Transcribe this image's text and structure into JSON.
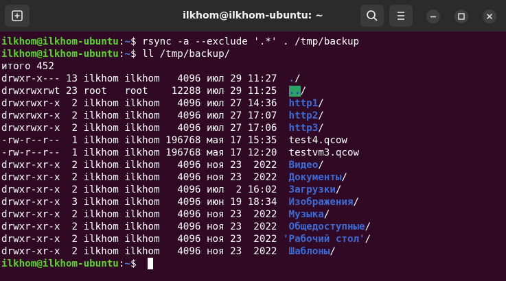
{
  "window": {
    "title": "ilkhom@ilkhom-ubuntu: ~"
  },
  "icons": {
    "new_tab": "new-tab-icon",
    "search": "search-icon",
    "menu": "hamburger-menu-icon",
    "minimize": "minimize-icon",
    "maximize": "maximize-icon",
    "close": "close-icon"
  },
  "colors": {
    "terminal_bg": "#300a24",
    "prompt_user": "#5ad42a",
    "prompt_path": "#4d7fd1",
    "directory": "#3d6bd6",
    "highlight_bg": "#2aa264"
  },
  "prompt": {
    "user_host": "ilkhom@ilkhom-ubuntu",
    "sep": ":",
    "path": "~",
    "symbol": "$ "
  },
  "commands": {
    "cmd1": "rsync -a --exclude '.*' . /tmp/backup",
    "cmd2": "ll /tmp/backup/"
  },
  "total_line": "итого 452",
  "listing": [
    {
      "perm": "drwxr-x--- 13 ilkhom ilkhom   4096 июл 29 11:27  ",
      "name": ".",
      "suffix": "/",
      "kind": "dir"
    },
    {
      "perm": "drwxrwxrwt 23 root   root    12288 июл 29 11:25  ",
      "name": "..",
      "suffix": "/",
      "kind": "sticky"
    },
    {
      "perm": "drwxrwxr-x  2 ilkhom ilkhom   4096 июл 27 14:36  ",
      "name": "http1",
      "suffix": "/",
      "kind": "dir"
    },
    {
      "perm": "drwxrwxr-x  2 ilkhom ilkhom   4096 июл 27 17:07  ",
      "name": "http2",
      "suffix": "/",
      "kind": "dir"
    },
    {
      "perm": "drwxrwxr-x  2 ilkhom ilkhom   4096 июл 27 17:06  ",
      "name": "http3",
      "suffix": "/",
      "kind": "dir"
    },
    {
      "perm": "-rw-r--r--  1 ilkhom ilkhom 196768 мая 17 15:35  ",
      "name": "test4.qcow",
      "suffix": "",
      "kind": "file"
    },
    {
      "perm": "-rw-r--r--  1 ilkhom ilkhom 196768 мая 17 12:20  ",
      "name": "testvm3.qcow",
      "suffix": "",
      "kind": "file"
    },
    {
      "perm": "drwxr-xr-x  2 ilkhom ilkhom   4096 ноя 23  2022  ",
      "name": "Видео",
      "suffix": "/",
      "kind": "dir"
    },
    {
      "perm": "drwxr-xr-x  2 ilkhom ilkhom   4096 ноя 23  2022  ",
      "name": "Документы",
      "suffix": "/",
      "kind": "dir"
    },
    {
      "perm": "drwxr-xr-x  2 ilkhom ilkhom   4096 июл  2 16:02  ",
      "name": "Загрузки",
      "suffix": "/",
      "kind": "dir"
    },
    {
      "perm": "drwxr-xr-x  3 ilkhom ilkhom   4096 июн 19 18:34  ",
      "name": "Изображения",
      "suffix": "/",
      "kind": "dir"
    },
    {
      "perm": "drwxr-xr-x  2 ilkhom ilkhom   4096 ноя 23  2022  ",
      "name": "Музыка",
      "suffix": "/",
      "kind": "dir"
    },
    {
      "perm": "drwxr-xr-x  2 ilkhom ilkhom   4096 ноя 23  2022  ",
      "name": "Общедоступные",
      "suffix": "/",
      "kind": "dir"
    },
    {
      "perm": "drwxr-xr-x  2 ilkhom ilkhom   4096 ноя 23  2022 ",
      "name": "'Рабочий стол'",
      "suffix": "/",
      "kind": "dir"
    },
    {
      "perm": "drwxr-xr-x  2 ilkhom ilkhom   4096 ноя 23  2022  ",
      "name": "Шаблоны",
      "suffix": "/",
      "kind": "dir"
    }
  ]
}
